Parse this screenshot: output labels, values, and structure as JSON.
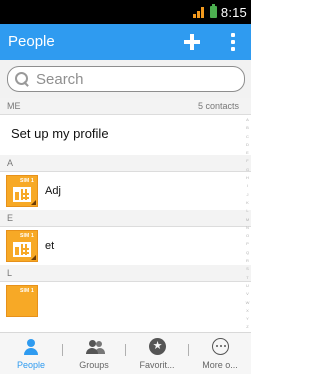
{
  "status_bar": {
    "time": "8:15"
  },
  "header": {
    "title": "People"
  },
  "search": {
    "placeholder": "Search"
  },
  "contacts": {
    "me_section": {
      "letter": "ME",
      "count": "5 contacts"
    },
    "profile_label": "Set up my profile",
    "sections": [
      {
        "letter": "A",
        "name": "Adj",
        "avatar_tag": "SIM 1"
      },
      {
        "letter": "E",
        "name": "et",
        "avatar_tag": "SIM 1"
      },
      {
        "letter": "L",
        "name": "",
        "avatar_tag": "SIM 1"
      }
    ]
  },
  "index_letters": "ABCDEFGHIJKLMNOPQRSTUVWXYZ#",
  "tabs": [
    {
      "label": "People",
      "icon": "person-icon",
      "active": true
    },
    {
      "label": "Groups",
      "icon": "groups-icon",
      "active": false
    },
    {
      "label": "Favorit...",
      "icon": "star-icon",
      "active": false
    },
    {
      "label": "More o...",
      "icon": "more-icon",
      "active": false
    }
  ],
  "colors": {
    "accent": "#2f9bf0",
    "sim_avatar": "#f7a926",
    "status_bar": "#000000"
  }
}
